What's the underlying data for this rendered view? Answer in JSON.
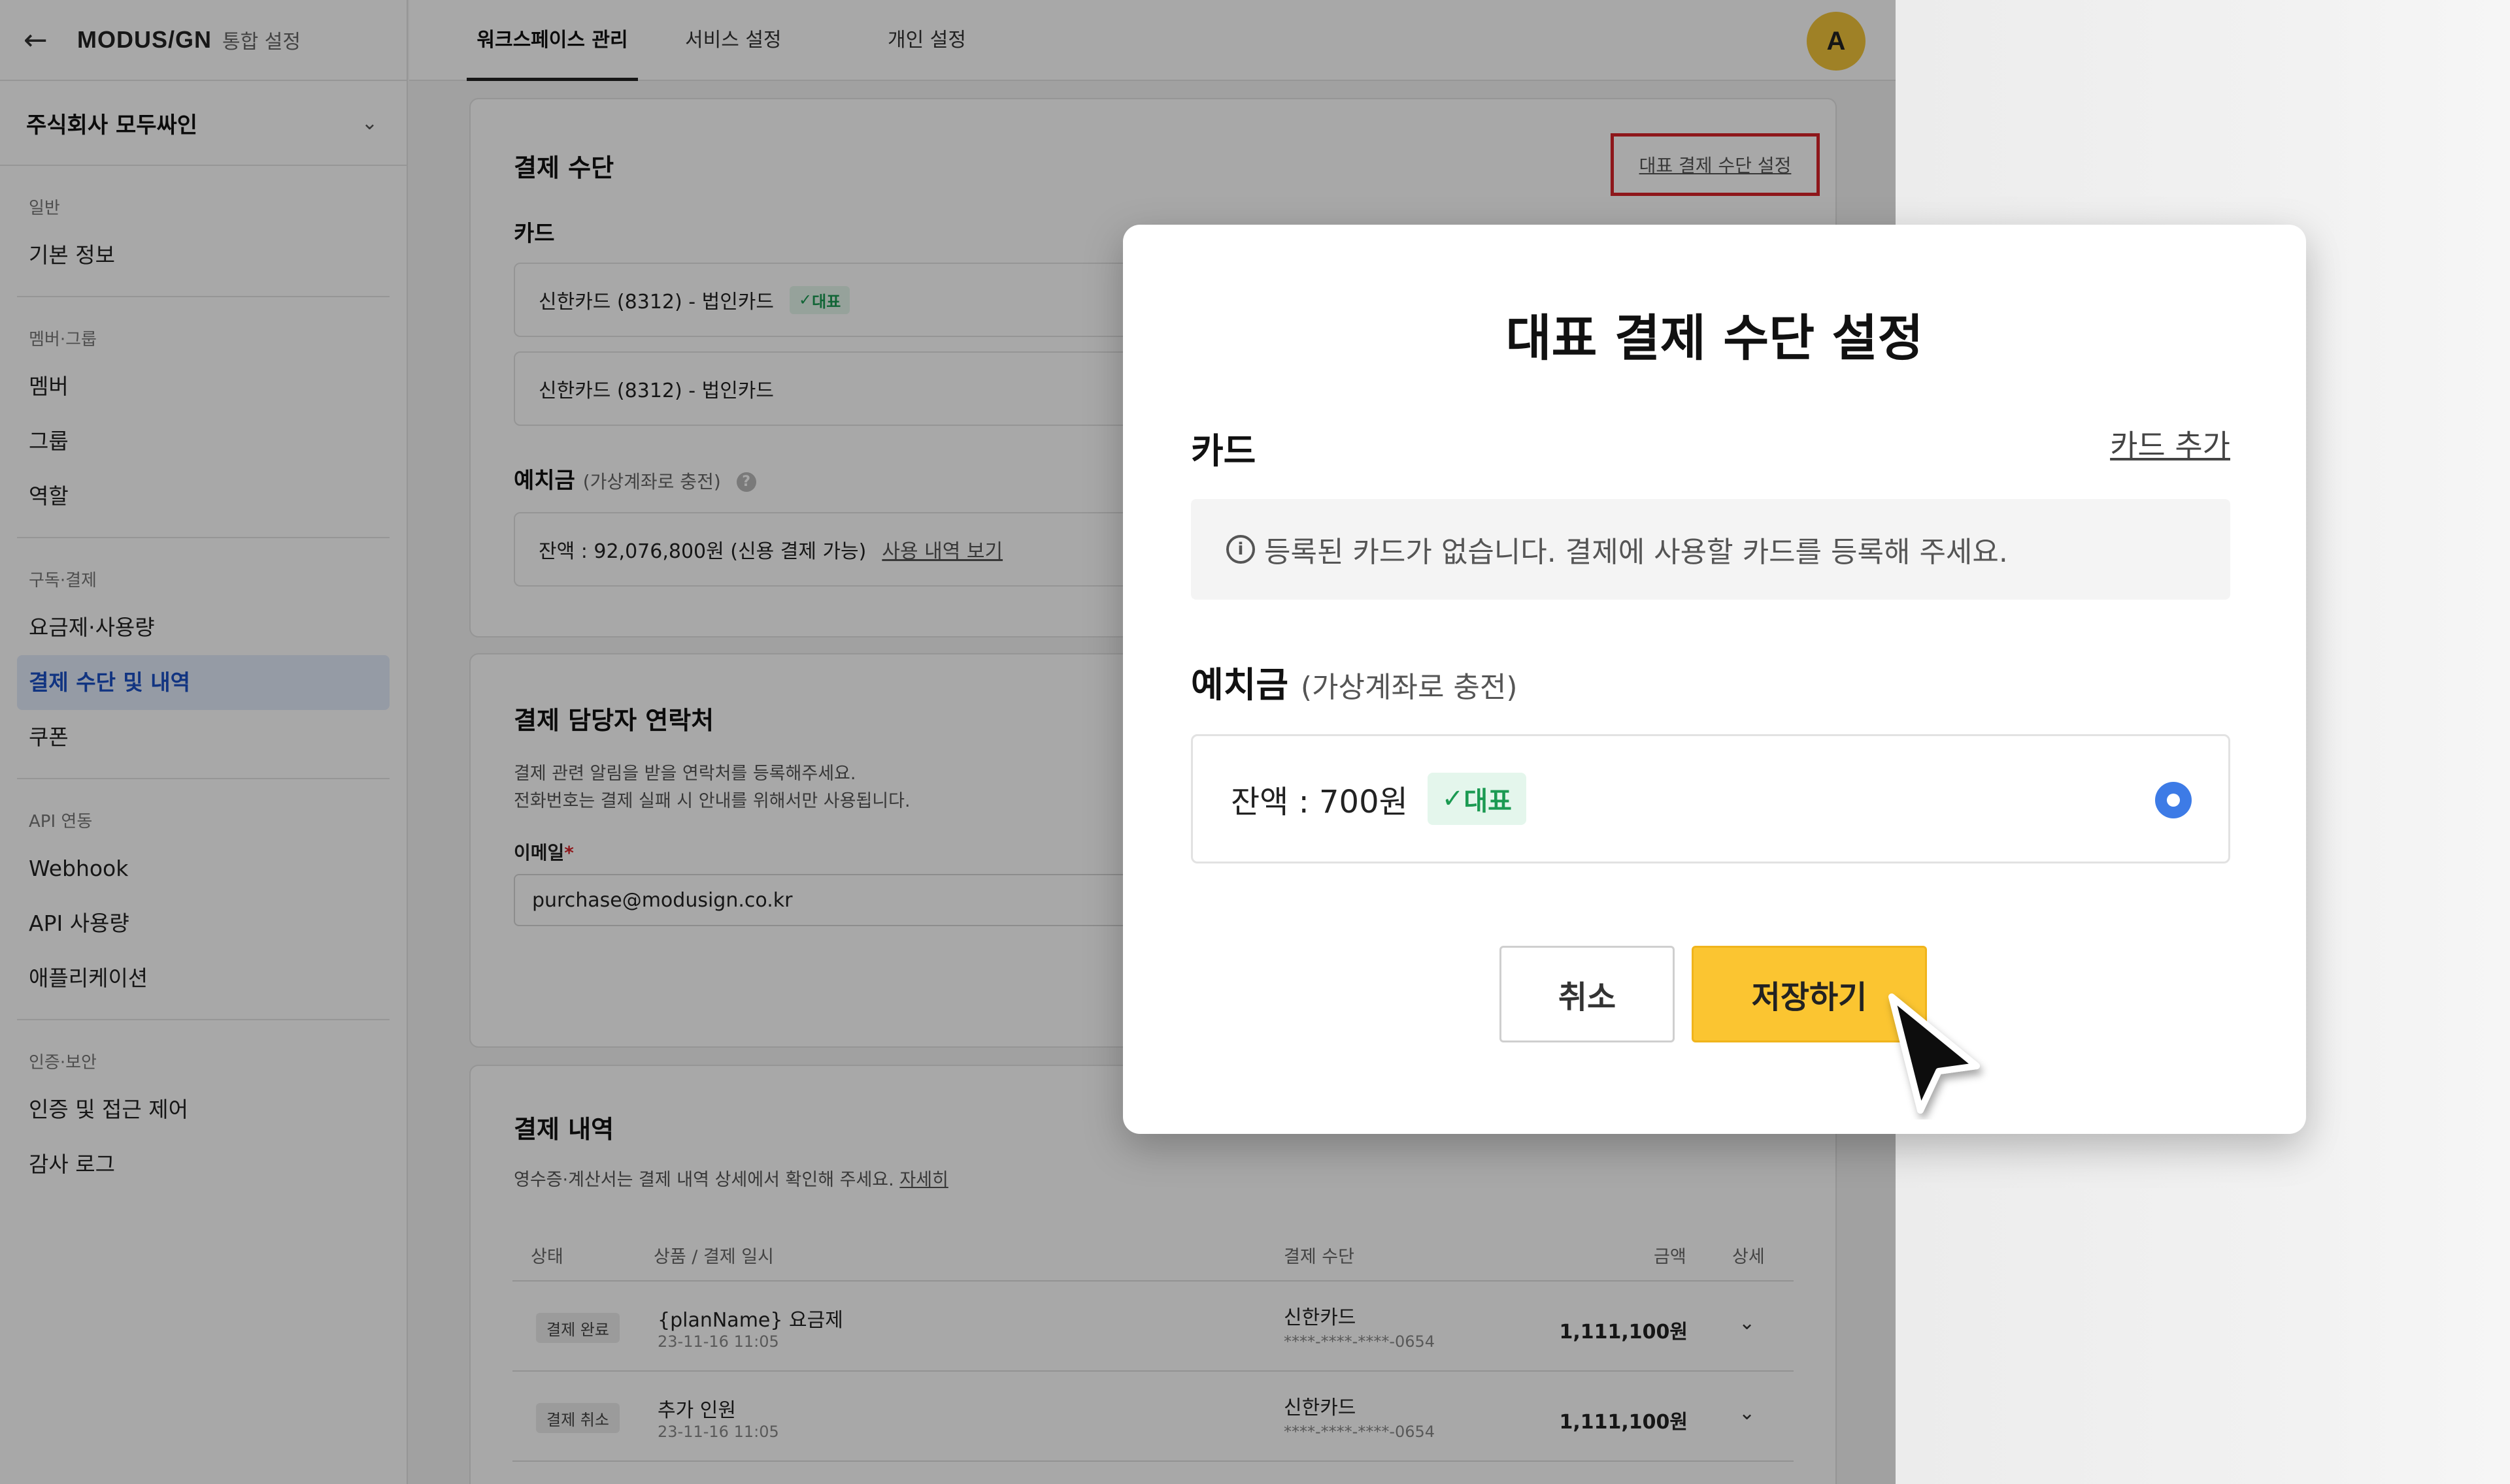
{
  "sidebar": {
    "brand": "MODUS/GN",
    "brand_sub": "통합 설정",
    "org_name": "주식회사 모두싸인",
    "sections": [
      {
        "category": "일반",
        "items": [
          {
            "label": "기본 정보"
          }
        ]
      },
      {
        "category": "멤버·그룹",
        "items": [
          {
            "label": "멤버"
          },
          {
            "label": "그룹"
          },
          {
            "label": "역할"
          }
        ]
      },
      {
        "category": "구독·결제",
        "items": [
          {
            "label": "요금제·사용량"
          },
          {
            "label": "결제 수단 및 내역",
            "active": true
          },
          {
            "label": "쿠폰"
          }
        ]
      },
      {
        "category": "API 연동",
        "items": [
          {
            "label": "Webhook"
          },
          {
            "label": "API 사용량"
          },
          {
            "label": "애플리케이션"
          }
        ]
      },
      {
        "category": "인증·보안",
        "items": [
          {
            "label": "인증 및 접근 제어"
          },
          {
            "label": "감사 로그"
          }
        ]
      }
    ]
  },
  "topnav": {
    "tabs": [
      {
        "label": "워크스페이스 관리",
        "active": true
      },
      {
        "label": "서비스 설정"
      },
      {
        "label": "개인 설정"
      }
    ],
    "avatar_initial": "A"
  },
  "payment_method": {
    "title": "결제 수단",
    "set_rep_link": "대표 결제 수단 설정",
    "card_heading": "카드",
    "cards": [
      {
        "label": "신한카드 (8312) - 법인카드",
        "badge": "대표"
      },
      {
        "label": "신한카드 (8312) - 법인카드"
      }
    ],
    "deposit_heading": "예치금",
    "deposit_sub": "(가상계좌로 충전)",
    "deposit_balance": "잔액 : 92,076,800원 (신용 결제 가능)",
    "deposit_link": "사용 내역 보기"
  },
  "contact": {
    "title": "결제 담당자 연락처",
    "desc_line1": "결제 관련 알림을 받을 연락처를 등록해주세요.",
    "desc_line2": "전화번호는 결제 실패 시 안내를 위해서만 사용됩니다.",
    "email_label": "이메일",
    "email_value": "purchase@modusign.co.kr"
  },
  "history": {
    "title": "결제 내역",
    "desc": "영수증·계산서는 결제 내역 상세에서 확인해 주세요.",
    "desc_link": "자세히",
    "columns": [
      "상태",
      "상품 / 결제 일시",
      "결제 수단",
      "금액",
      "상세"
    ],
    "rows": [
      {
        "status": "결제 완료",
        "product": "{planName} 요금제",
        "date": "23-11-16 11:05",
        "method": "신한카드",
        "method_sub": "****-****-****-0654",
        "amount": "1,111,100원"
      },
      {
        "status": "결제 취소",
        "product": "추가 인원",
        "date": "23-11-16 11:05",
        "method": "신한카드",
        "method_sub": "****-****-****-0654",
        "amount": "1,111,100원"
      }
    ]
  },
  "modal": {
    "title": "대표 결제 수단 설정",
    "card_heading": "카드",
    "add_card": "카드 추가",
    "empty_message": "등록된 카드가 없습니다. 결제에 사용할 카드를 등록해 주세요.",
    "deposit_heading": "예치금",
    "deposit_sub": "(가상계좌로 충전)",
    "deposit_balance": "잔액 : 700원",
    "deposit_badge": "대표",
    "cancel_label": "취소",
    "save_label": "저장하기"
  },
  "colors": {
    "accent_yellow": "#fbc531",
    "active_blue": "#1b4fc4",
    "radio_blue": "#3d7be6",
    "badge_green": "#1b9a52",
    "highlight_red": "#d8232a"
  }
}
